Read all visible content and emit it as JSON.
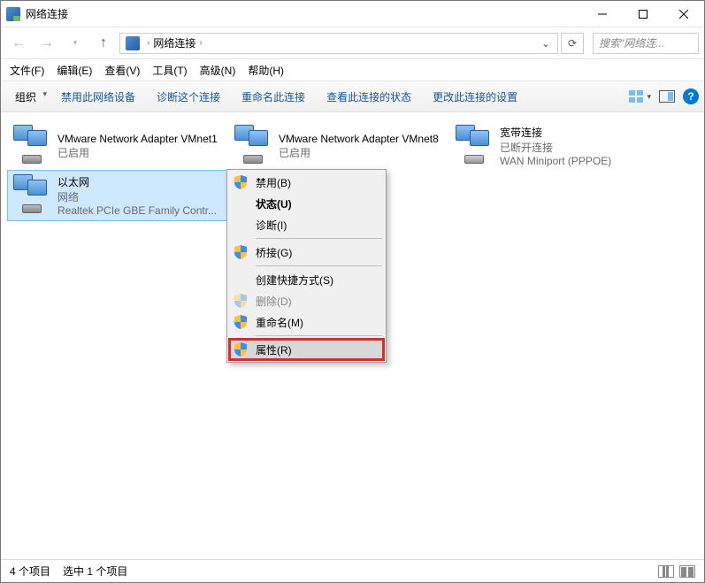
{
  "window": {
    "title": "网络连接"
  },
  "breadcrumb": {
    "location": "网络连接",
    "sep": "›"
  },
  "search": {
    "placeholder": "搜索\"网络连..."
  },
  "menubar": [
    {
      "label": "文件(F)"
    },
    {
      "label": "编辑(E)"
    },
    {
      "label": "查看(V)"
    },
    {
      "label": "工具(T)"
    },
    {
      "label": "高级(N)"
    },
    {
      "label": "帮助(H)"
    }
  ],
  "toolbar": {
    "organize": "组织",
    "links": [
      "禁用此网络设备",
      "诊断这个连接",
      "重命名此连接",
      "查看此连接的状态",
      "更改此连接的设置"
    ]
  },
  "adapters": [
    {
      "name": "VMware Network Adapter VMnet1",
      "status": "已启用",
      "device": ""
    },
    {
      "name": "VMware Network Adapter VMnet8",
      "status": "已启用",
      "device": ""
    },
    {
      "name": "宽带连接",
      "status": "已断开连接",
      "device": "WAN Miniport (PPPOE)"
    },
    {
      "name": "以太网",
      "status": "网络",
      "device": "Realtek PCIe GBE Family Contr..."
    }
  ],
  "context_menu": {
    "disable": "禁用(B)",
    "status": "状态(U)",
    "diagnose": "诊断(I)",
    "bridge": "桥接(G)",
    "shortcut": "创建快捷方式(S)",
    "delete": "删除(D)",
    "rename": "重命名(M)",
    "properties": "属性(R)"
  },
  "statusbar": {
    "count": "4 个项目",
    "selected": "选中 1 个项目"
  }
}
